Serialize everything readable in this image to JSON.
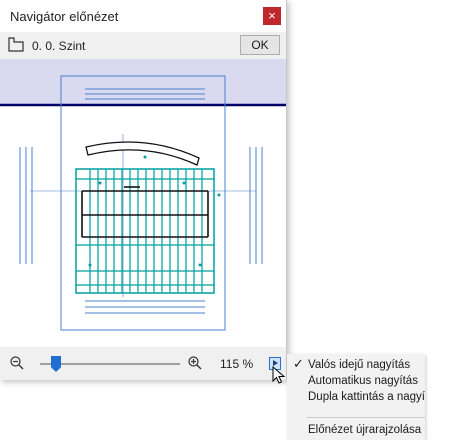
{
  "window": {
    "title": "Navigátor előnézet",
    "close_glyph": "×"
  },
  "toolbar": {
    "story_icon": "story-icon",
    "story_label": "0. 0. Szint",
    "ok_label": "OK"
  },
  "preview": {
    "accent_band": "#d9d9f0",
    "story_line": "#000066",
    "drawing_color": "#00a0a0",
    "frame_color": "#4a7fd0"
  },
  "zoom": {
    "zoom_out_icon": "zoom-out-icon",
    "zoom_in_icon": "zoom-in-icon",
    "value": "115 %",
    "slider_level": 0.12
  },
  "menu": {
    "items": [
      {
        "label": "Valós idejű nagyítás",
        "checked": "✓"
      },
      {
        "label": "Automatikus nagyítás"
      },
      {
        "label": "Dupla kattintás a nagyí"
      },
      {
        "label": "Előnézet újrarajzolása"
      }
    ]
  }
}
